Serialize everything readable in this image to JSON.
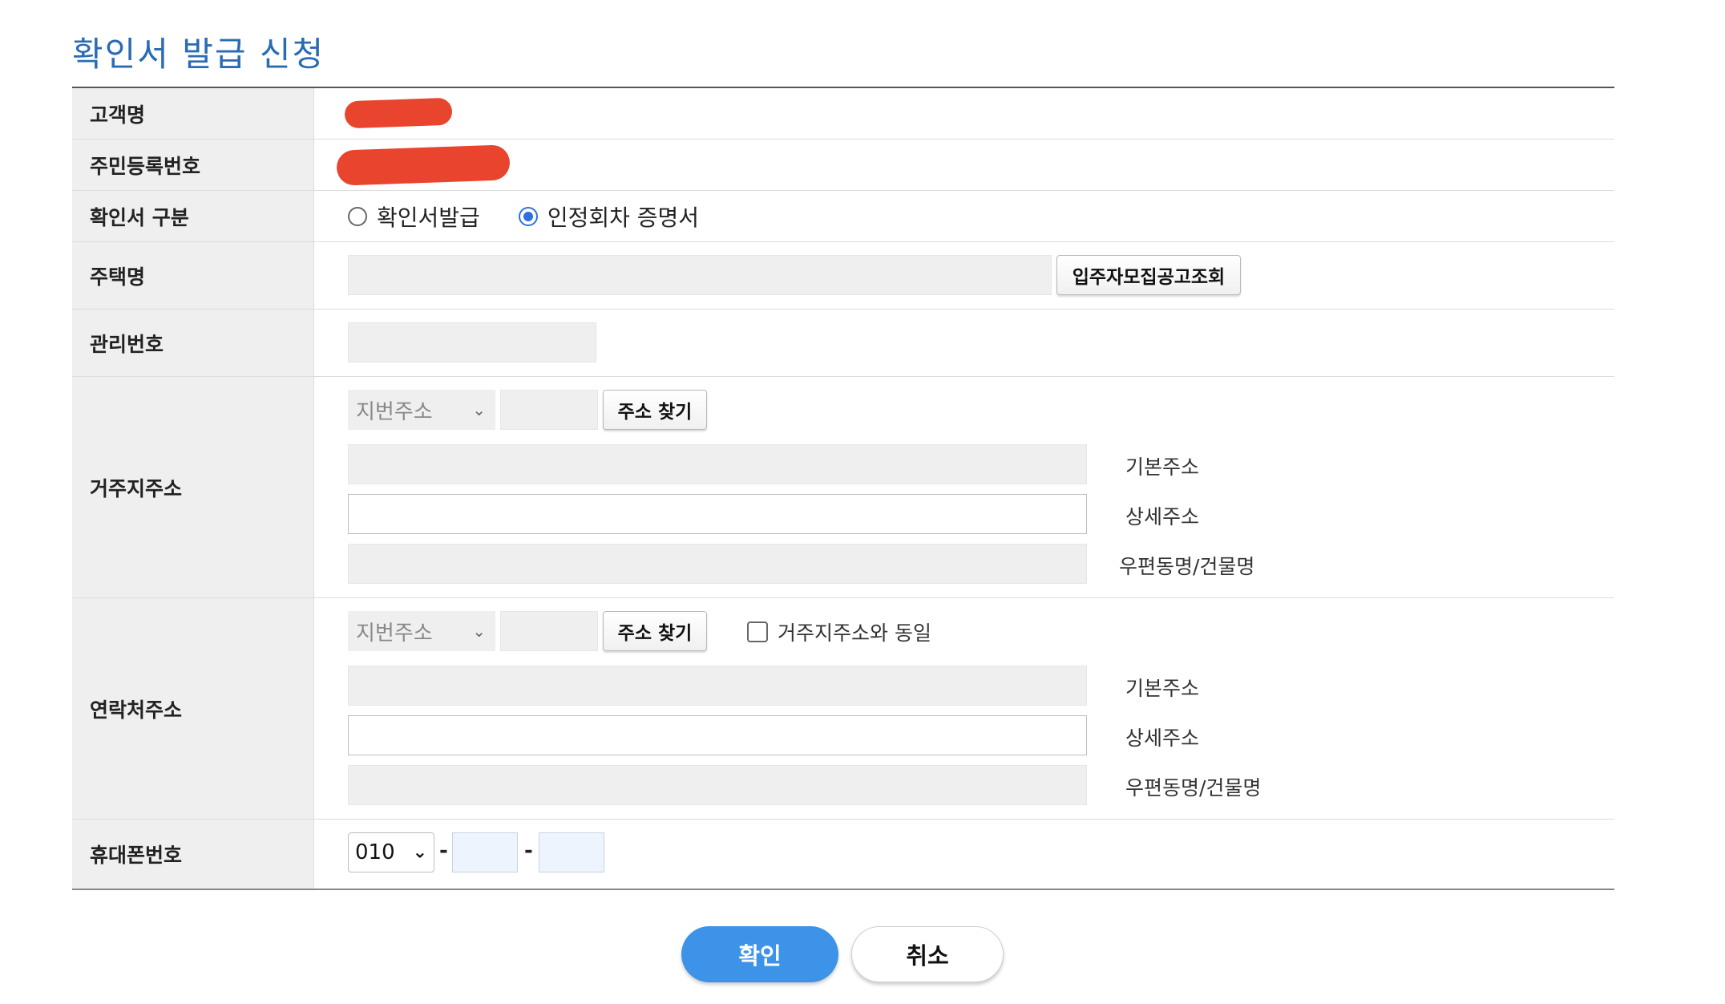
{
  "page": {
    "title": "확인서 발급 신청"
  },
  "form": {
    "customer_name": {
      "label": "고객명"
    },
    "resident_number": {
      "label": "주민등록번호"
    },
    "certificate_type": {
      "label": "확인서 구분",
      "options": [
        {
          "label": "확인서발급",
          "selected": false
        },
        {
          "label": "인정회차 증명서",
          "selected": true
        }
      ]
    },
    "housing_name": {
      "label": "주택명",
      "search_button": "입주자모집공고조회"
    },
    "management_number": {
      "label": "관리번호"
    },
    "residence_address": {
      "label": "거주지주소",
      "address_type": "지번주소",
      "find_button": "주소 찾기",
      "basic_label": "기본주소",
      "detail_label": "상세주소",
      "building_label": "우편동명/건물명"
    },
    "contact_address": {
      "label": "연락처주소",
      "address_type": "지번주소",
      "find_button": "주소 찾기",
      "same_as_residence": "거주지주소와 동일",
      "basic_label": "기본주소",
      "detail_label": "상세주소",
      "building_label": "우편동명/건물명"
    },
    "mobile": {
      "label": "휴대폰번호",
      "prefix": "010",
      "separator": "-"
    }
  },
  "actions": {
    "confirm": "확인",
    "cancel": "취소"
  },
  "colors": {
    "title": "#2a6bb5",
    "primary_button": "#3d93e8",
    "redaction": "#e8442e",
    "radio_selected": "#2f6fe0"
  }
}
